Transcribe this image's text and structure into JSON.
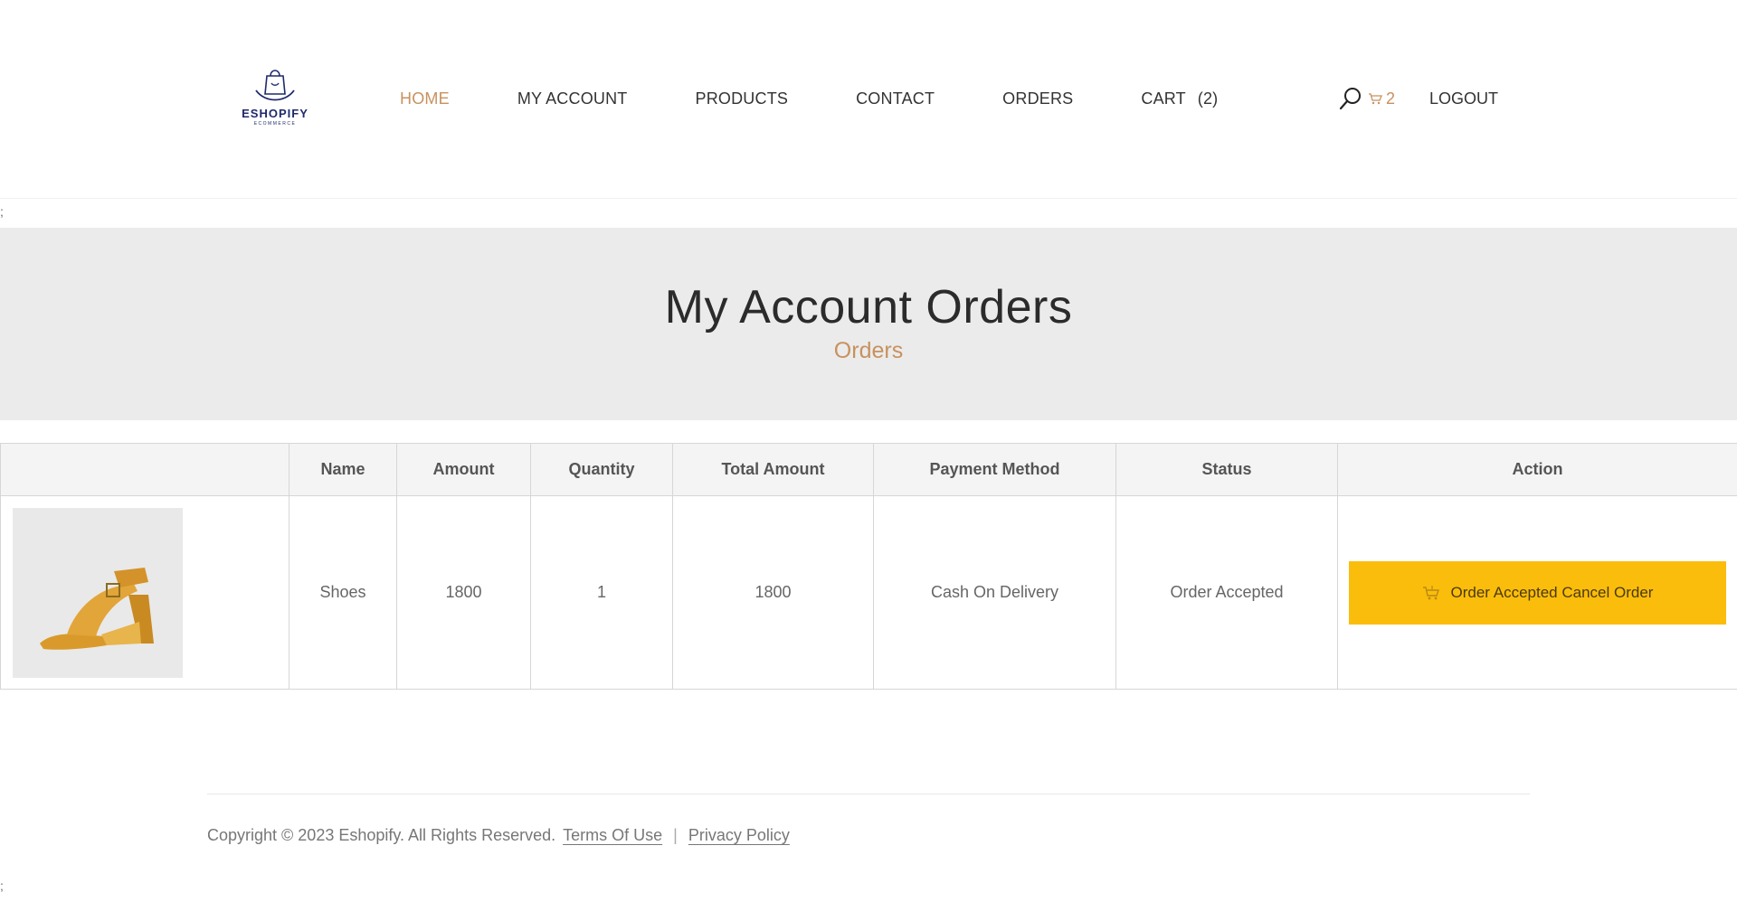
{
  "header": {
    "logo": {
      "name": "ESHOPIFY",
      "tagline": "ECOMMERCE"
    },
    "nav": [
      {
        "label": "HOME",
        "active": true
      },
      {
        "label": "MY ACCOUNT",
        "active": false
      },
      {
        "label": "PRODUCTS",
        "active": false
      },
      {
        "label": "CONTACT",
        "active": false
      },
      {
        "label": "ORDERS",
        "active": false
      },
      {
        "label": "CART",
        "count": "(2)",
        "active": false
      }
    ],
    "cart_mini_count": "2",
    "logout_label": "LOGOUT",
    "icons": {
      "search": "search-icon",
      "cart": "cart-icon"
    }
  },
  "stray_marks": [
    ";",
    ";"
  ],
  "banner": {
    "title": "My Account Orders",
    "subtitle": "Orders"
  },
  "orders_table": {
    "columns": [
      "",
      "Name",
      "Amount",
      "Quantity",
      "Total Amount",
      "Payment Method",
      "Status",
      "Action"
    ],
    "rows": [
      {
        "image": "product-image-sandal",
        "name": "Shoes",
        "amount": "1800",
        "quantity": "1",
        "total_amount": "1800",
        "payment_method": "Cash On Delivery",
        "status": "Order Accepted",
        "action_label": "Order Accepted Cancel Order"
      }
    ]
  },
  "footer": {
    "copyright": "Copyright © 2023 Eshopify. All Rights Reserved.",
    "links": [
      "Terms Of Use",
      "Privacy Policy"
    ],
    "separator": "|"
  },
  "colors": {
    "accent": "#c8915f",
    "action_button": "#fbbd0b",
    "banner_bg": "#ebebeb",
    "logo": "#1f2a6b"
  }
}
